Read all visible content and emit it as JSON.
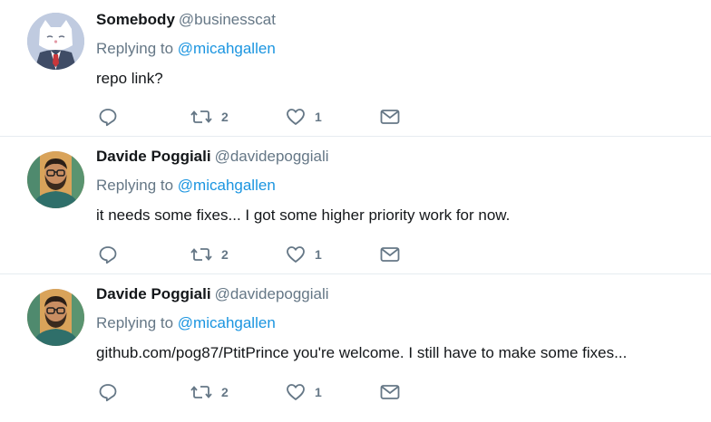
{
  "tweets": [
    {
      "name": "Somebody",
      "handle": "@businesscat",
      "replying_prefix": "Replying to",
      "replying_to": "@micahgallen",
      "text": "repo link?",
      "retweets": "2",
      "likes": "1",
      "avatar": "cat-in-suit-avatar"
    },
    {
      "name": "Davide Poggiali",
      "handle": "@davidepoggiali",
      "replying_prefix": "Replying to",
      "replying_to": "@micahgallen",
      "text": "it needs some fixes... I got some higher priority work for now.",
      "retweets": "2",
      "likes": "1",
      "avatar": "bearded-man-avatar"
    },
    {
      "name": "Davide Poggiali",
      "handle": "@davidepoggiali",
      "replying_prefix": "Replying to",
      "replying_to": "@micahgallen",
      "text": "github.com/pog87/PtitPrince you're welcome. I still have to make some fixes...",
      "retweets": "2",
      "likes": "1",
      "avatar": "bearded-man-avatar"
    }
  ],
  "colors": {
    "link": "#1b95e0",
    "muted": "#657786",
    "text": "#14171a",
    "divider": "#e6ecf0"
  }
}
